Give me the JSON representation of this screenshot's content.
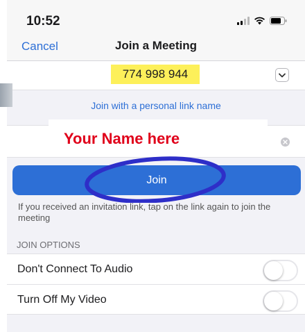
{
  "status_bar": {
    "time": "10:52",
    "icons": [
      "signal-icon",
      "wifi-icon",
      "battery-icon"
    ]
  },
  "nav": {
    "cancel_label": "Cancel",
    "title": "Join a Meeting"
  },
  "meeting": {
    "id": "774 998 944",
    "dropdown_icon": "chevron-down-icon"
  },
  "personal_link_label": "Join with a personal link name",
  "name_field": {
    "value": "",
    "overlay_text": "Your Name here",
    "clear_icon": "clear-icon"
  },
  "join_button": {
    "label": "Join"
  },
  "hint_text": "If you received an invitation link, tap on the link again to join the meeting",
  "join_options": {
    "header": "JOIN OPTIONS",
    "items": [
      {
        "label": "Don't Connect To Audio",
        "enabled": false
      },
      {
        "label": "Turn Off My Video",
        "enabled": false
      }
    ]
  },
  "colors": {
    "accent": "#2d6fd6",
    "highlight": "#fdf05a",
    "overlay_text": "#e0001a",
    "annotation_circle": "#2e2ec8"
  }
}
